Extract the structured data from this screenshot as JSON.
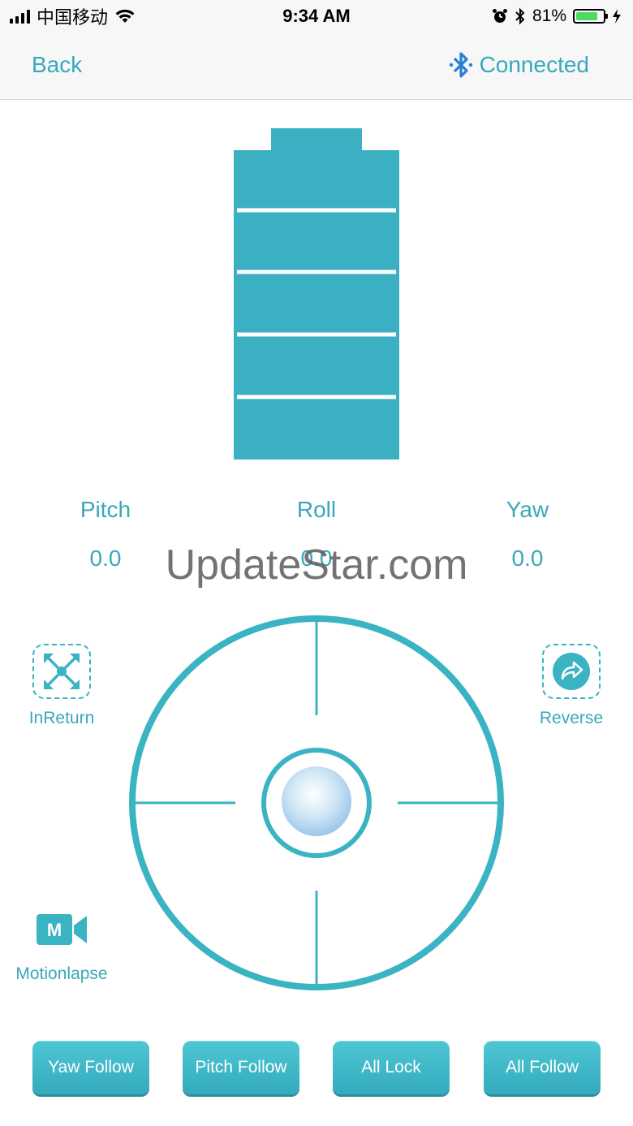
{
  "status_bar": {
    "carrier": "中国移动",
    "time": "9:34 AM",
    "battery_percent": "81%",
    "battery_level": 0.81,
    "icons": [
      "signal-icon",
      "wifi-icon",
      "alarm-icon",
      "bluetooth-icon",
      "battery-icon",
      "charging-icon"
    ]
  },
  "nav": {
    "back_label": "Back",
    "connection_status": "Connected",
    "accent_color": "#36a9bd"
  },
  "battery": {
    "segments": 5,
    "color": "#3ab0c2"
  },
  "angles": {
    "pitch_label": "Pitch",
    "pitch_value": "0.0",
    "roll_label": "Roll",
    "roll_value": "0.0",
    "yaw_label": "Yaw",
    "yaw_value": "0.0"
  },
  "side_buttons": {
    "inreturn_label": "InReturn",
    "reverse_label": "Reverse",
    "motionlapse_label": "Motionlapse",
    "motionlapse_icon_letter": "M"
  },
  "modes": {
    "yaw_follow": "Yaw Follow",
    "pitch_follow": "Pitch Follow",
    "all_lock": "All Lock",
    "all_follow": "All Follow"
  },
  "watermark": "UpdateStar.com"
}
